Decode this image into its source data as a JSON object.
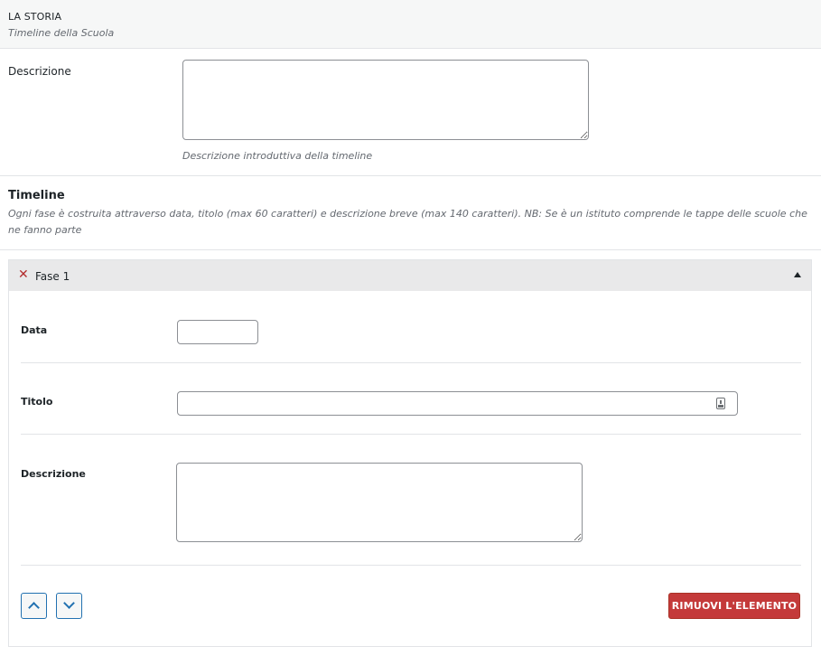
{
  "section": {
    "title": "LA STORIA",
    "subtitle": "Timeline della Scuola"
  },
  "description_field": {
    "label": "Descrizione",
    "value": "",
    "help": "Descrizione introduttiva della timeline"
  },
  "timeline": {
    "title": "Timeline",
    "description": "Ogni fase è costruita attraverso data, titolo (max 60 caratteri) e descrizione breve (max 140 caratteri). NB: Se è un istituto comprende le tappe delle scuole che ne fanno parte",
    "group": {
      "name": "Fase 1",
      "remove_icon": "close-x-icon",
      "toggle_icon": "triangle-up-icon",
      "fields": {
        "data_label": "Data",
        "data_value": "",
        "titolo_label": "Titolo",
        "titolo_value": "",
        "descrizione_label": "Descrizione",
        "descrizione_value": ""
      },
      "actions": {
        "move_up_icon": "chevron-up-icon",
        "move_down_icon": "chevron-down-icon",
        "remove_label": "RIMUOVI L'ELEMENTO"
      }
    }
  },
  "colors": {
    "accent": "#2271b1",
    "danger": "#c43a3a",
    "header_bg": "#f6f7f7",
    "group_title_bg": "#e9e9ea"
  }
}
